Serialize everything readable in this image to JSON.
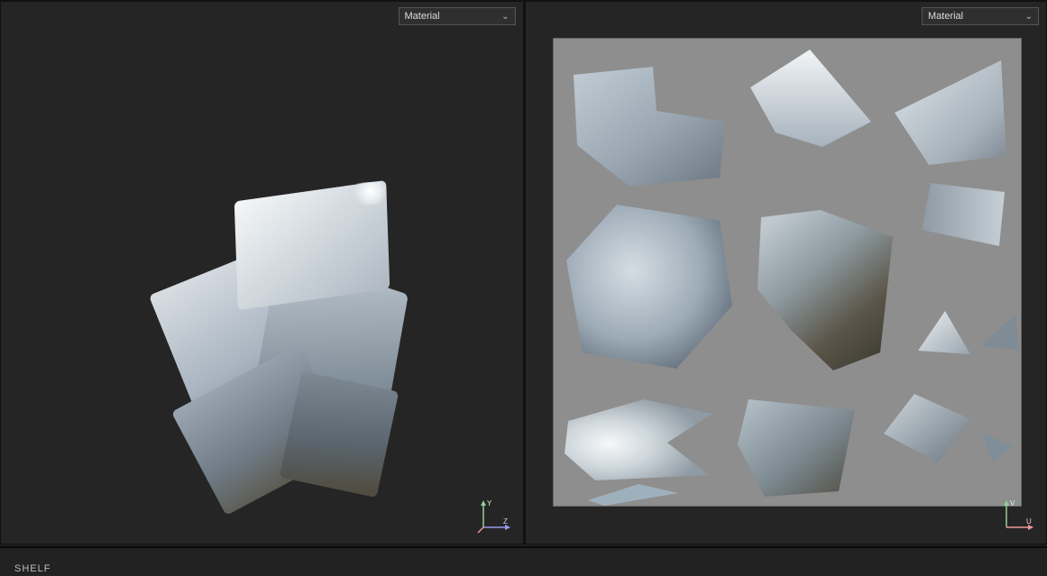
{
  "viewport_left": {
    "shading_mode": "Material",
    "axes": {
      "up": "Y",
      "right": "Z"
    }
  },
  "viewport_right": {
    "shading_mode": "Material",
    "axes": {
      "up": "V",
      "right": "U"
    }
  },
  "footer": {
    "panel_label": "SHELF"
  }
}
